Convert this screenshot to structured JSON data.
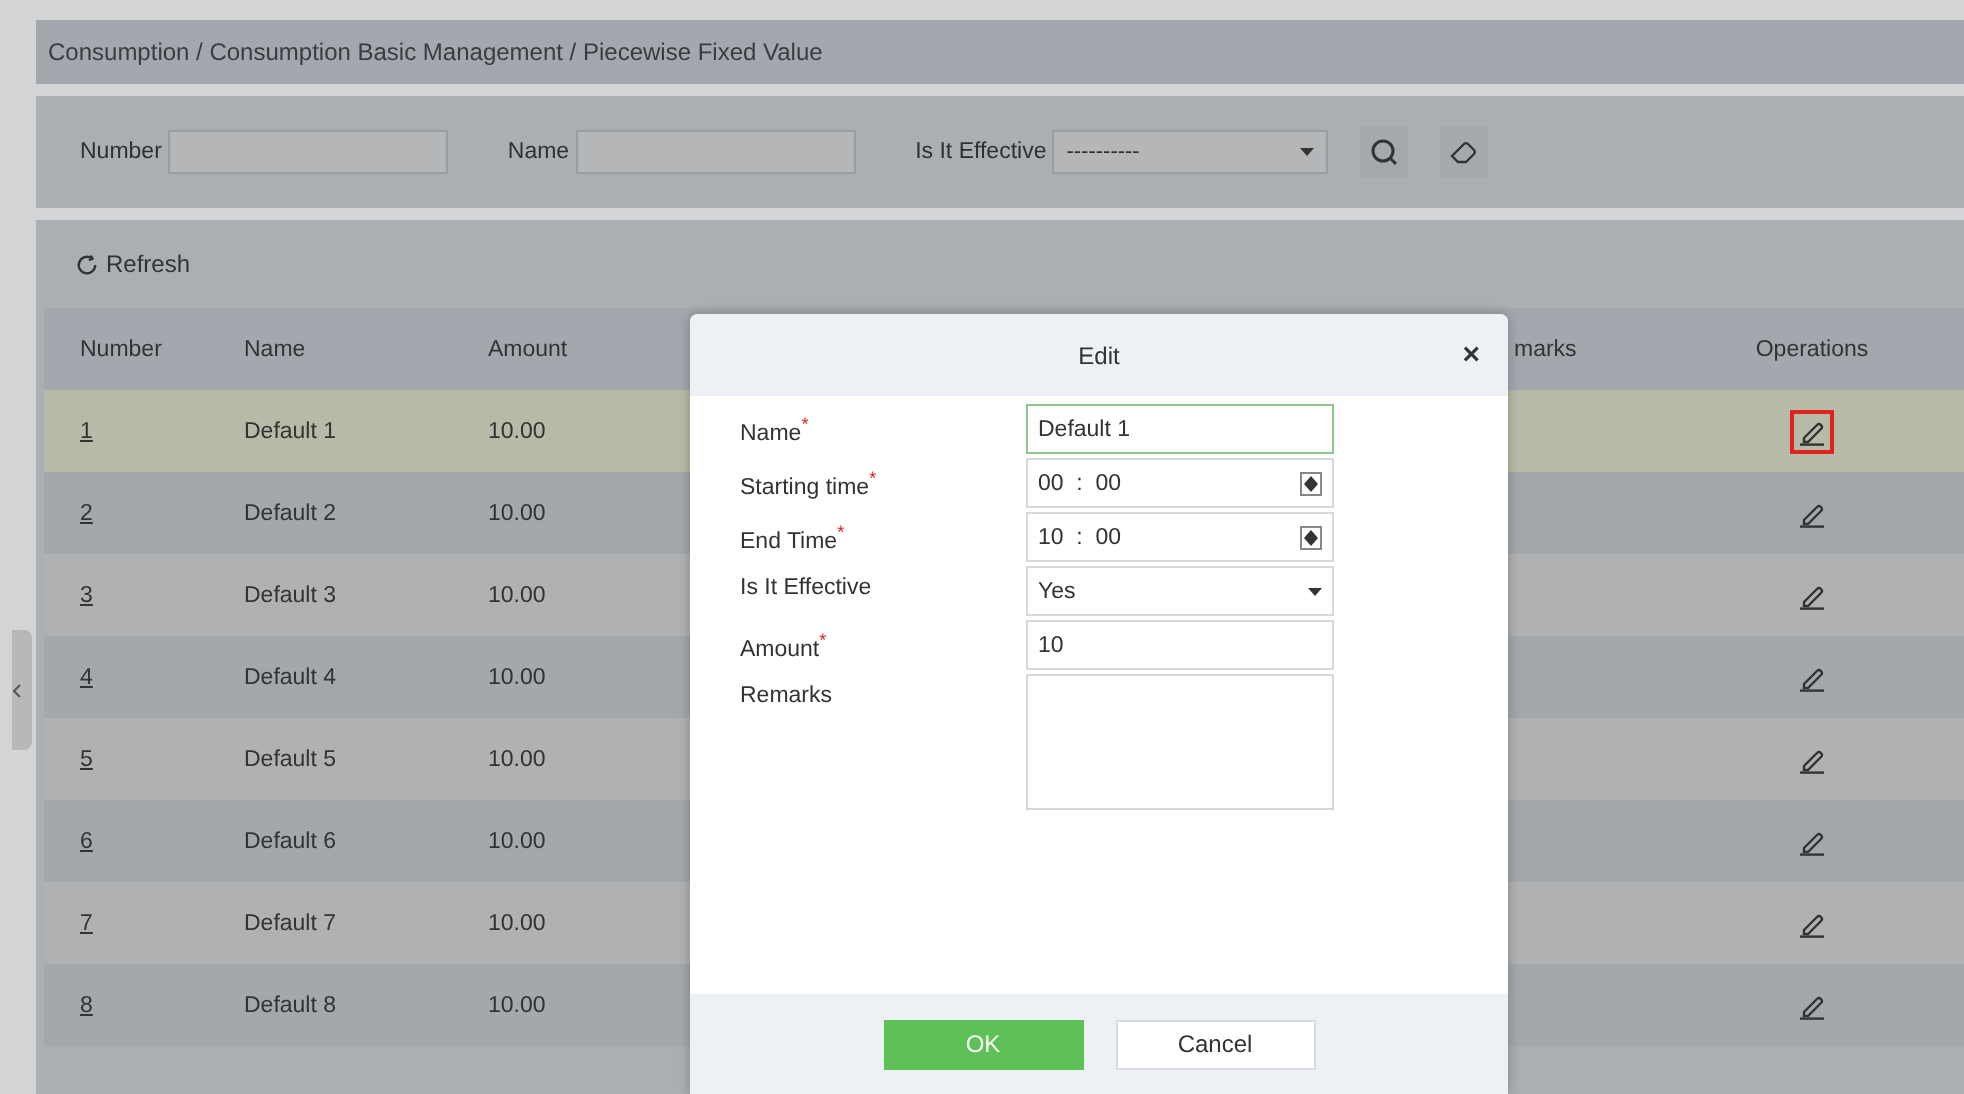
{
  "breadcrumb": "Consumption / Consumption Basic Management / Piecewise Fixed Value",
  "filters": [
    {
      "kind": "text",
      "label": "Number"
    },
    {
      "kind": "text",
      "label": "Name"
    },
    {
      "kind": "select",
      "label": "Is It Effective",
      "value": "----------"
    }
  ],
  "toolbar": {
    "refresh": "Refresh"
  },
  "table": {
    "columns": [
      "Number",
      "Name",
      "Amount",
      "",
      "marks",
      "Operations"
    ],
    "rows": [
      {
        "number": "1",
        "name": "Default 1",
        "amount": "10.00",
        "selected": true
      },
      {
        "number": "2",
        "name": "Default 2",
        "amount": "10.00",
        "selected": false
      },
      {
        "number": "3",
        "name": "Default 3",
        "amount": "10.00",
        "selected": false
      },
      {
        "number": "4",
        "name": "Default 4",
        "amount": "10.00",
        "selected": false
      },
      {
        "number": "5",
        "name": "Default 5",
        "amount": "10.00",
        "selected": false
      },
      {
        "number": "6",
        "name": "Default 6",
        "amount": "10.00",
        "selected": false
      },
      {
        "number": "7",
        "name": "Default 7",
        "amount": "10.00",
        "selected": false
      },
      {
        "number": "8",
        "name": "Default 8",
        "amount": "10.00",
        "selected": false
      }
    ]
  },
  "dialog": {
    "title": "Edit",
    "close": "×",
    "fields": [
      {
        "kind": "text",
        "label": "Name$^{*}$",
        "value": "Default 1",
        "focused": true
      },
      {
        "kind": "time",
        "label": "Starting time$^{*}$",
        "value": "00  :  00"
      },
      {
        "kind": "time",
        "label": "End Time$^{*}$",
        "value": "10  :  00"
      },
      {
        "kind": "select",
        "label": "Is It Effective",
        "value": "Yes"
      },
      {
        "kind": "text",
        "label": "Amount$^{*}$",
        "value": "10",
        "focused": false
      },
      {
        "kind": "textarea",
        "label": "Remarks"
      }
    ],
    "buttons": [
      {
        "kind": "primary",
        "label": "OK"
      },
      {
        "kind": "secondary",
        "label": "Cancel"
      }
    ]
  }
}
